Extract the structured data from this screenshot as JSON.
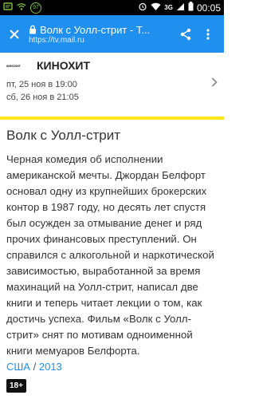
{
  "status_bar": {
    "badge_count": "97",
    "network": "3G",
    "clock": "00:05"
  },
  "toolbar": {
    "title": "Волк с Уолл-стрит - Т...",
    "url": "https://tv.mail.ru"
  },
  "schedule": {
    "logo_text": "КИНОХИТ",
    "channel_name": "КИНОХИТ",
    "times": [
      "пт, 25 ноя в 19:00",
      "сб, 26 ноя в 21:05"
    ]
  },
  "film": {
    "title": "Волк с Уолл-стрит",
    "description": "Черная комедия об исполнении американской мечты. Джордан Белфорт основал одну из крупнейших брокерских контор в 1987 году, но десять лет спустя был осужден за отмывание денег и ряд прочих финансовых преступлений. Он справился с алкогольной и наркотической зависимостью, выработанной за время махинаций на Уолл-стрит, написал две книги и теперь читает лекции о том, как достичь успеха. Фильм «Волк с Уолл-стрит» снят по мотивам одноименной книги мемуаров Белфорта.",
    "country": "США",
    "separator": "/",
    "year": "2013",
    "age_rating": "18+"
  },
  "colors": {
    "toolbar": "#1f8ff0",
    "accent_line": "#ffe51a",
    "link": "#1f8ff0"
  }
}
